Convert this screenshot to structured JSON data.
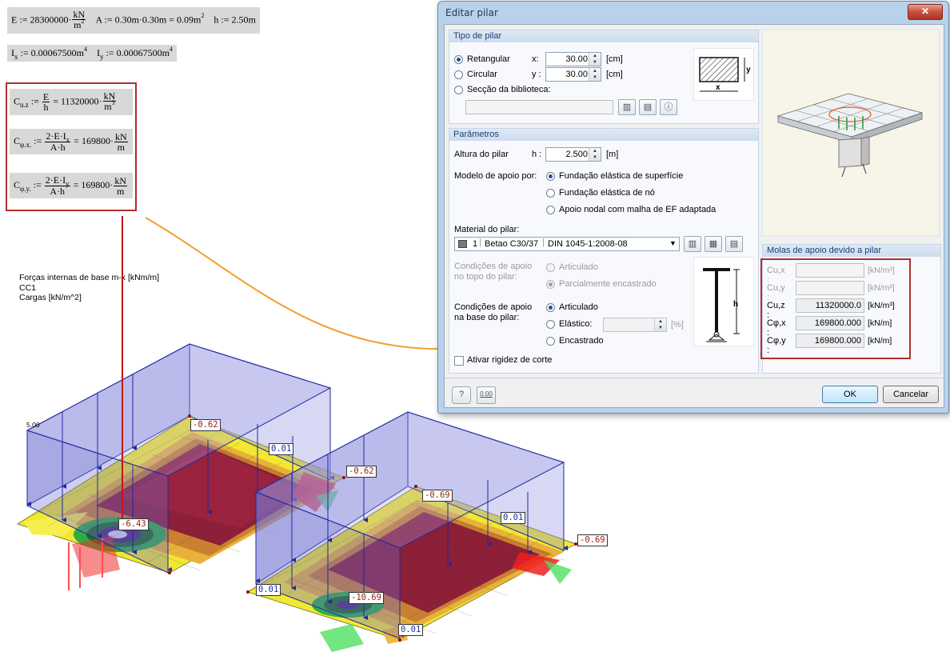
{
  "mathcad": {
    "line1": {
      "e_name": "E",
      "e_value": "28300000",
      "e_unit_num": "kN",
      "e_unit_den": "m",
      "e_unit_pow": "2",
      "a_name": "A",
      "a_expr": "0.30m·0.30m = 0.09m",
      "a_pow": "2",
      "h_name": "h",
      "h_value": "2.50m"
    },
    "line2": {
      "ix_name": "I",
      "ix_sub": "x",
      "ix_value": "0.00067500m",
      "ix_pow": "4",
      "iy_name": "I",
      "iy_sub": "y",
      "iy_value": "0.00067500m",
      "iy_pow": "4"
    },
    "cuz": {
      "name": "C",
      "sub": "u.z",
      "frac_n": "E",
      "frac_d": "h",
      "value": "11320000",
      "unit_n": "kN",
      "unit_d": "m",
      "unit_pow": "3"
    },
    "cpx": {
      "name": "C",
      "sub": "φ.x.",
      "frac_n": "2·E·I",
      "frac_n_sub": "x",
      "frac_d": "A·h",
      "value": "169800",
      "unit_n": "kN",
      "unit_d": "m"
    },
    "cpy": {
      "name": "C",
      "sub": "φ.y.",
      "frac_n": "2·E·I",
      "frac_n_sub": "y",
      "frac_d": "A·h",
      "value": "169800",
      "unit_n": "kN",
      "unit_d": "m"
    },
    "assign": ":=",
    "eq": "=",
    "dot": "·"
  },
  "viewport": {
    "info_lines": [
      "Forças internas de base m-x [kNm/m]",
      "CC1",
      "Cargas [kN/m^2]"
    ],
    "load_value": "5.00",
    "labels": [
      {
        "text": "-0.62",
        "kind": "red"
      },
      {
        "text": "0.01",
        "kind": "blue"
      },
      {
        "text": "-0.62",
        "kind": "red"
      },
      {
        "text": "-6.43",
        "kind": "red"
      },
      {
        "text": "-0.69",
        "kind": "red"
      },
      {
        "text": "0.01",
        "kind": "blue"
      },
      {
        "text": "-0.69",
        "kind": "red"
      },
      {
        "text": "0.01",
        "kind": "blue"
      },
      {
        "text": "-10.69",
        "kind": "red"
      },
      {
        "text": "0.01",
        "kind": "blue"
      }
    ]
  },
  "dialog": {
    "title": "Editar pilar",
    "close": "✕",
    "tipo": {
      "header": "Tipo de pilar",
      "retangular": "Retangular",
      "circular": "Circular",
      "biblioteca": "Secção da biblioteca:",
      "x_label": "x:",
      "x_value": "30.00",
      "x_unit": "[cm]",
      "y_label": "y :",
      "y_value": "30.00",
      "y_unit": "[cm]",
      "sketch_x": "x",
      "sketch_y": "y"
    },
    "param": {
      "header": "Parâmetros",
      "altura_label": "Altura do pilar",
      "h_label": "h :",
      "h_value": "2.500",
      "h_unit": "[m]",
      "modelo_label": "Modelo de apoio por:",
      "modelo_opts": [
        "Fundação elástica de superfície",
        "Fundação elástica de nó",
        "Apoio nodal com malha de EF adaptada"
      ],
      "material_label": "Material do pilar:",
      "material_num": "1",
      "material_name": "Betao C30/37",
      "material_norm": "DIN 1045-1:2008-08",
      "topo_label": "Condições de apoio no topo do pilar:",
      "topo_opts": [
        "Articulado",
        "Parcialmente encastrado"
      ],
      "base_label": "Condições de apoio na base do pilar:",
      "base_opts": [
        "Articulado",
        "Elástico:",
        "Encastrado"
      ],
      "base_unit": "[%]",
      "sketch_h": "h",
      "rigidez": "Ativar rigidez de corte"
    },
    "molas": {
      "header": "Molas de apoio devido a pilar",
      "rows": [
        {
          "name": "Cu,x :",
          "value": "",
          "unit": "[kN/m³]",
          "enabled": false
        },
        {
          "name": "Cu,y :",
          "value": "",
          "unit": "[kN/m³]",
          "enabled": false
        },
        {
          "name": "Cu,z :",
          "value": "11320000.0",
          "unit": "[kN/m³]",
          "enabled": true
        },
        {
          "name": "Cφ,x :",
          "value": "169800.000",
          "unit": "[kN/m]",
          "enabled": true
        },
        {
          "name": "Cφ,y :",
          "value": "169800.000",
          "unit": "[kN/m]",
          "enabled": true
        }
      ]
    },
    "ok": "OK",
    "cancel": "Cancelar",
    "units_icon": "0.00"
  },
  "colors": {
    "highlight": "#b0302a",
    "arrow_orange": "#f0a030",
    "arrow_red": "#c01818",
    "load_box": "#7f7fd6"
  }
}
